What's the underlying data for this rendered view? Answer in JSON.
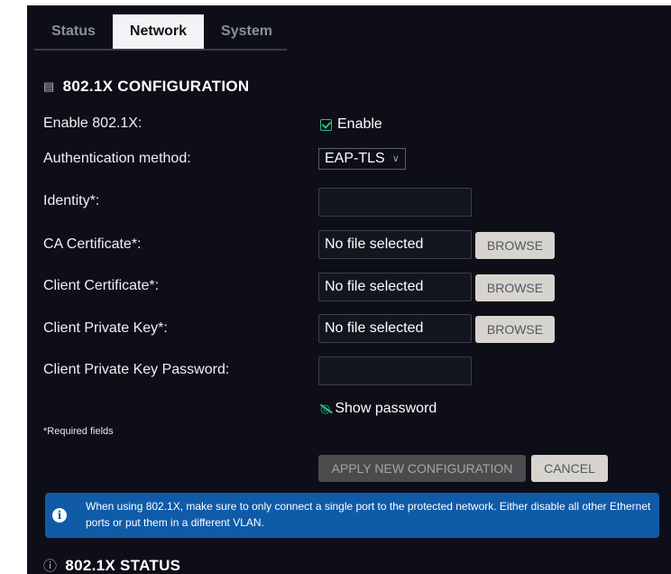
{
  "tabs": [
    {
      "label": "Status"
    },
    {
      "label": "Network"
    },
    {
      "label": "System"
    }
  ],
  "active_tab": "Network",
  "config": {
    "title": "802.1X CONFIGURATION",
    "title_icon": "id-card-icon",
    "enable_label": "Enable 802.1X:",
    "enable_option": "Enable",
    "auth_label": "Authentication method:",
    "auth_value": "EAP-TLS",
    "identity_label": "Identity*:",
    "identity_value": "",
    "ca_label": "CA Certificate*:",
    "ca_value": "No file selected",
    "client_cert_label": "Client Certificate*:",
    "client_cert_value": "No file selected",
    "private_key_label": "Client Private Key*:",
    "private_key_value": "No file selected",
    "password_label": "Client Private Key Password:",
    "password_value": "",
    "browse_label": "BROWSE",
    "show_password": "Show password",
    "required_note": "*Required fields",
    "apply_label": "APPLY NEW CONFIGURATION",
    "cancel_label": "CANCEL"
  },
  "info": {
    "text": "When using 802.1X, make sure to only connect a single port to the protected network. Either disable all other Ethernet ports or put them in a different VLAN."
  },
  "status": {
    "title": "802.1X STATUS",
    "title_icon": "info-circle-icon"
  },
  "colors": {
    "background": "#0d0e17",
    "accent_green": "#26c281",
    "info_blue": "#0f5ba8"
  }
}
